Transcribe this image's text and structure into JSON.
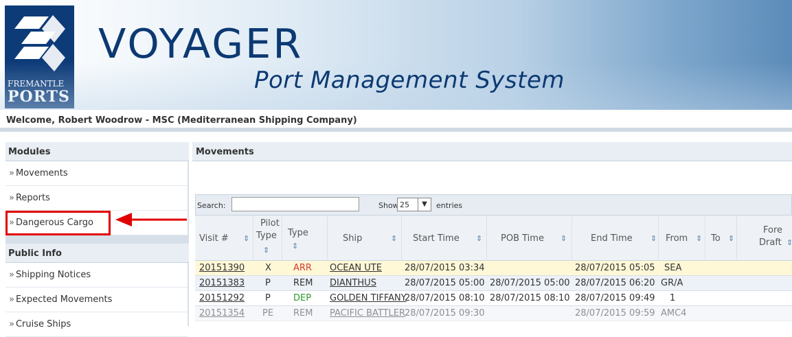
{
  "header": {
    "logo_top": "FREMANTLE",
    "logo_bottom": "PORTS",
    "title": "VOYAGER",
    "subtitle": "Port Management System"
  },
  "welcome": "Welcome, Robert Woodrow - MSC (Mediterranean Shipping Company)",
  "sidebar": {
    "modules_title": "Modules",
    "modules": [
      {
        "label": "Movements"
      },
      {
        "label": "Reports"
      },
      {
        "label": "Dangerous Cargo"
      }
    ],
    "public_title": "Public Info",
    "public": [
      {
        "label": "Shipping Notices"
      },
      {
        "label": "Expected Movements"
      },
      {
        "label": "Cruise Ships"
      }
    ],
    "bullet": "»"
  },
  "main": {
    "title": "Movements",
    "search_label": "Search:",
    "search_value": "",
    "show_label": "Show",
    "page_size": "25",
    "entries_label": "entries",
    "columns": {
      "visit": "Visit #",
      "pilot_1": "Pilot",
      "pilot_2": "Type",
      "type": "Type",
      "ship": "Ship",
      "start": "Start Time",
      "pob": "POB Time",
      "end": "End Time",
      "from": "From",
      "to": "To",
      "fore_1": "Fore",
      "fore_2": "Draft"
    },
    "rows": [
      {
        "visit": "20151390",
        "pilot": "X",
        "type": "ARR",
        "type_color": "#d23b2f",
        "ship": "OCEAN UTE",
        "start": "28/07/2015 03:34",
        "pob": "",
        "end": "28/07/2015 05:05",
        "from": "SEA"
      },
      {
        "visit": "20151383",
        "pilot": "P",
        "type": "REM",
        "type_color": "#333333",
        "ship": "DIANTHUS",
        "start": "28/07/2015 05:00",
        "pob": "28/07/2015 05:00",
        "end": "28/07/2015 06:20",
        "from": "GR/A"
      },
      {
        "visit": "20151292",
        "pilot": "P",
        "type": "DEP",
        "type_color": "#2e9a2e",
        "ship": "GOLDEN TIFFANY",
        "start": "28/07/2015 08:10",
        "pob": "28/07/2015 08:10",
        "end": "28/07/2015 09:49",
        "from": "1"
      },
      {
        "visit": "20151354",
        "pilot": "PE",
        "type": "REM",
        "type_color": "#333333",
        "ship": "PACIFIC BATTLER",
        "start": "28/07/2015 09:30",
        "pob": "",
        "end": "28/07/2015 09:59",
        "from": "AMC4"
      }
    ]
  }
}
